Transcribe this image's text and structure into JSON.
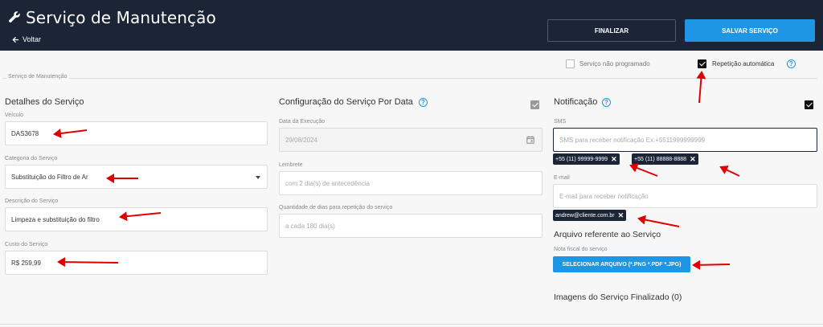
{
  "header": {
    "title": "Serviço de Manutenção",
    "back_label": "Voltar",
    "finalizar_label": "FINALIZAR",
    "salvar_label": "SALVAR SERVIÇO"
  },
  "options": {
    "nao_programado_label": "Serviço não programado",
    "nao_programado_checked": false,
    "repeticao_label": "Repetição automática",
    "repeticao_checked": true
  },
  "fieldset_legend": "Serviço de Manutenção",
  "detalhes": {
    "title": "Detalhes do Serviço",
    "veiculo_label": "Veículo",
    "veiculo_value": "DAS3678",
    "categoria_label": "Categoria do Serviço",
    "categoria_value": "Substituição do Filtro de Ar",
    "descricao_label": "Descrição do Serviço",
    "descricao_value": "Limpeza e substituição do filtro",
    "custo_label": "Custo do Serviço",
    "custo_value": "R$ 259,99"
  },
  "configuracao": {
    "title": "Configuração do Serviço Por Data",
    "checked": true,
    "data_label": "Data da Execução",
    "data_value": "29/08/2024",
    "lembrete_label": "Lembrete",
    "lembrete_placeholder": "com 2 dia(s) de antecedência",
    "quantidade_label": "Quantidade de dias para repetição do serviço",
    "quantidade_placeholder": "a cada 180 dia(s)"
  },
  "notificacao": {
    "title": "Notificação",
    "checked": true,
    "sms_label": "SMS",
    "sms_placeholder": "SMS para receber notificação Ex:+5511999999999",
    "sms_chips": [
      "+55 (11) 99999-9999",
      "+55 (11) 88888-8888"
    ],
    "email_label": "E-mail",
    "email_placeholder": "E-mail para receber notificação",
    "email_chips": [
      "andrew@cliente.com.br"
    ]
  },
  "arquivo": {
    "title": "Arquivo referente ao Serviço",
    "nota_label": "Nota fiscal do serviço",
    "upload_label": "SELECIONAR ARQUIVO (*.PNG *.PDF *.JPG)"
  },
  "imagens": {
    "title": "Imagens do Serviço Finalizado (0)"
  },
  "colors": {
    "header_bg": "#1b2535",
    "accent": "#1e96e3",
    "annotation_arrow": "#e00000"
  },
  "icons": {
    "title_icon": "wrench-icon",
    "back_icon": "arrow-left-icon",
    "help_icon": "question-circle-icon",
    "calendar_icon": "calendar-icon",
    "close_icon": "close-icon",
    "dropdown_icon": "caret-down-icon"
  }
}
